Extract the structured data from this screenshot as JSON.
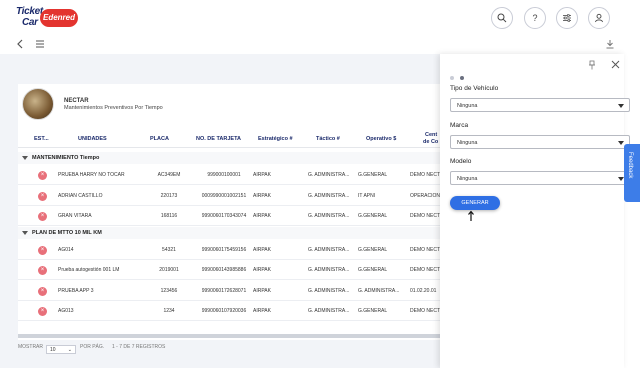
{
  "header": {
    "logo": {
      "line1": "Ticket",
      "line2": "Car",
      "badge": "Edenred"
    }
  },
  "profile": {
    "name": "NECTAR",
    "subtitle": "Mantenimientos Preventivos Por Tiempo"
  },
  "table": {
    "columns": [
      "EST...",
      "UNIDADES",
      "PLACA",
      "NO. DE TARJETA",
      "Estratégico #",
      "Táctico #",
      "Operativo $",
      "Cent",
      "de Co"
    ],
    "groups": [
      {
        "title": "MANTENIMIENTO Tiempo",
        "rows": [
          {
            "unidad": "PRUEBA HARRY NO TOCAR",
            "placa": "AC349EM",
            "tarjeta": "999000100001",
            "estrategico": "AIRPAK",
            "tactico": "G. ADMINISTRA...",
            "operativo": "G.GENERAL",
            "centro": "DEMO NECT"
          },
          {
            "unidad": "ADRIAN CASTILLO",
            "placa": "220173",
            "tarjeta": "0009990001002151",
            "estrategico": "AIRPAK",
            "tactico": "G. ADMINISTRA...",
            "operativo": "IT APNI",
            "centro": "OPERACION"
          },
          {
            "unidad": "GRAN VITARA",
            "placa": "168116",
            "tarjeta": "9990060170343074",
            "estrategico": "AIRPAK",
            "tactico": "G. ADMINISTRA...",
            "operativo": "G.GENERAL",
            "centro": "DEMO NECT"
          }
        ]
      },
      {
        "title": "PLAN DE MTTO 10 MIL KM",
        "rows": [
          {
            "unidad": "AG014",
            "placa": "54321",
            "tarjeta": "9990060175459156",
            "estrategico": "AIRPAK",
            "tactico": "G. ADMINISTRA...",
            "operativo": "G.GENERAL",
            "centro": "DEMO NECT"
          },
          {
            "unidad": "Prueba autogestión 001 LM",
            "placa": "2019001",
            "tarjeta": "9990060143985886",
            "estrategico": "AIRPAK",
            "tactico": "G. ADMINISTRA...",
            "operativo": "G.GENERAL",
            "centro": "DEMO NECT"
          },
          {
            "unidad": "PRUEBA APP 3",
            "placa": "123456",
            "tarjeta": "9990060172628071",
            "estrategico": "AIRPAK",
            "tactico": "G. ADMINISTRA...",
            "operativo": "G. ADMINISTRA...",
            "centro": "01.02.20.01"
          },
          {
            "unidad": "AG013",
            "placa": "1234",
            "tarjeta": "9990060107920036",
            "estrategico": "AIRPAK",
            "tactico": "G. ADMINISTRA...",
            "operativo": "G.GENERAL",
            "centro": "DEMO NECT"
          }
        ]
      }
    ]
  },
  "footer": {
    "mostrar": "MOSTRAR",
    "per_page": "10",
    "por_pag": "POR PÁG.",
    "registros": "1 - 7 DE 7 REGISTROS"
  },
  "side_panel": {
    "fields": [
      {
        "label": "Tipo de Vehículo",
        "value": "Ninguna"
      },
      {
        "label": "Marca",
        "value": "Ninguna"
      },
      {
        "label": "Modelo",
        "value": "Ninguna"
      }
    ],
    "generate_label": "GENERAR"
  },
  "feedback_label": "Feedback",
  "colors": {
    "brand": "#1b2a6b",
    "accent": "#2f6fe4",
    "badge": "#e3342f",
    "delete": "#e8707a"
  }
}
